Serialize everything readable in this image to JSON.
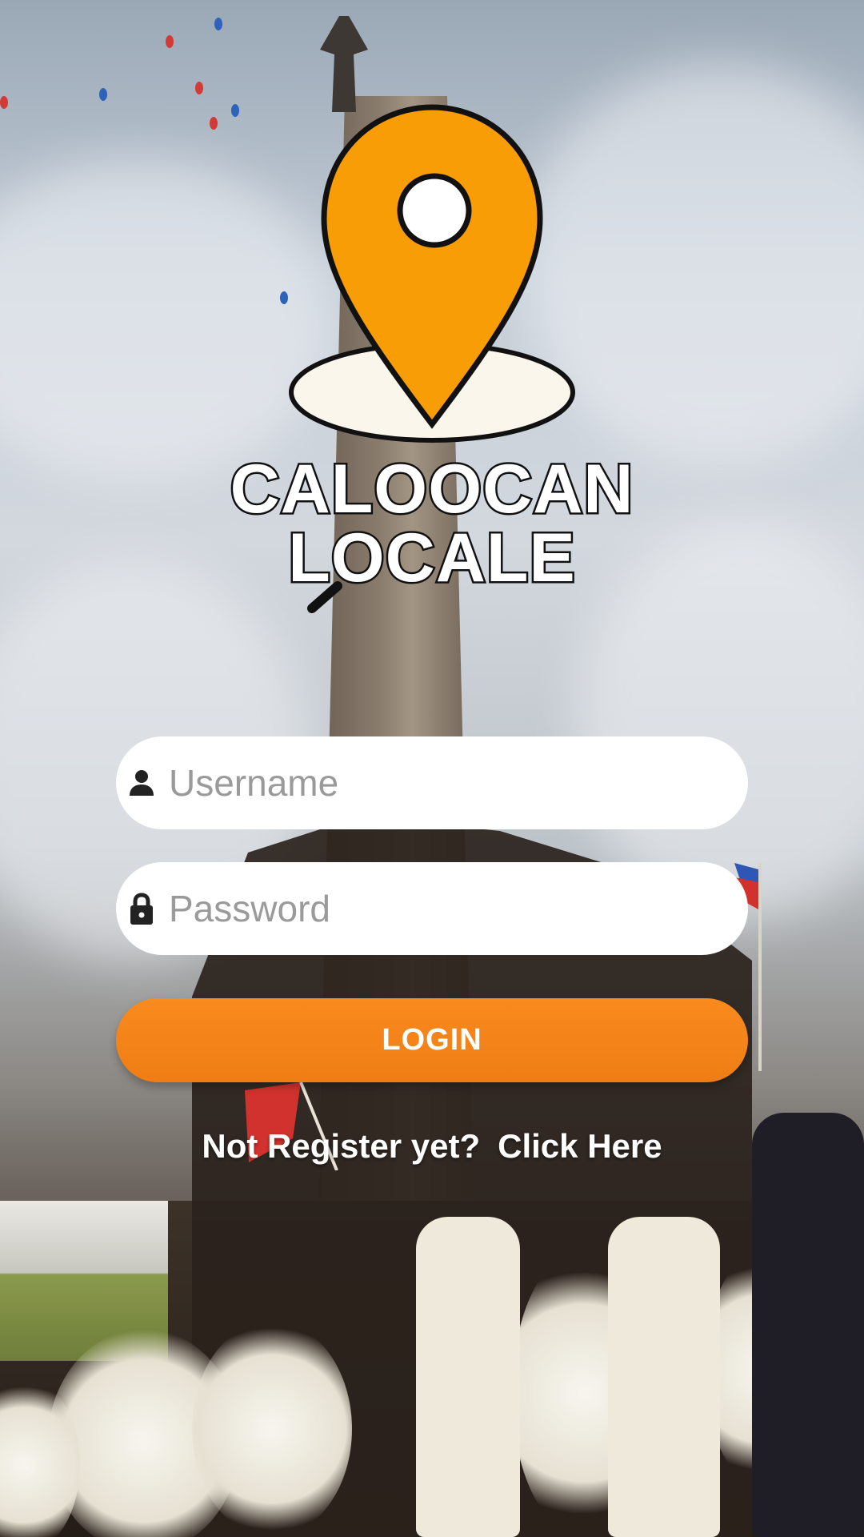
{
  "app": {
    "logo_line1": "CALOOCAN",
    "logo_line2": "LOCALE"
  },
  "form": {
    "username_placeholder": "Username",
    "password_placeholder": "Password",
    "login_label": "LOGIN"
  },
  "register": {
    "prompt": "Not Register yet?",
    "link_label": "Click Here"
  },
  "icons": {
    "username": "person-icon",
    "password": "lock-icon",
    "logo": "map-pin-icon"
  },
  "colors": {
    "accent": "#F7871A",
    "pin": "#F99D07",
    "pin_base": "#FBF6EC",
    "field_bg": "#FFFFFF",
    "placeholder": "#9A9A9A"
  }
}
